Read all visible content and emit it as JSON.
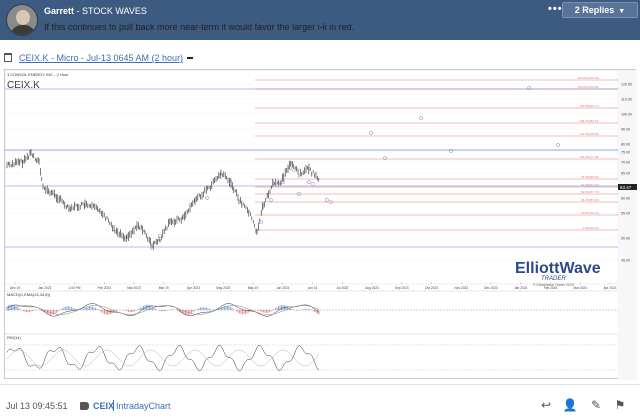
{
  "post": {
    "author": "Garrett",
    "separator": " - ",
    "thread_title": "STOCK WAVES",
    "replies_label": "2 Replies",
    "more_label": "•••",
    "message": "If this continues to pull back more near-term it would favor the larger i-ii in red.",
    "attachment_label": "CEIX.K - Micro - Jul-13 0645 AM (2 hour)",
    "timestamp": "Jul 13 09:45:51",
    "tag_symbol": "CEIX",
    "tag_chart": "IntradayChart"
  },
  "icons": {
    "trash": "trash-icon",
    "more": "more-dots-icon",
    "chevron": "chevron-down-icon",
    "tag": "tag-icon",
    "reply": "reply-icon",
    "add_user": "add-user-icon",
    "edit": "edit-icon",
    "flag": "flag-icon"
  },
  "colors": {
    "header_bg": "#3d5a80",
    "link": "#3d6fb6",
    "fib_line": "#e07a7a",
    "price_line": "#6b7fd6",
    "candles": "#222222"
  },
  "chart_data": {
    "type": "line",
    "symbol_title": "CEIX.K",
    "company_line": "1 CONSOL ENERGY INC - 2 Hour",
    "x_labels": [
      "Dec 19",
      "Jan 2023",
      "1:00 PM",
      "Feb 2023",
      "Mar 2023",
      "Mar 19",
      "Apr 2023",
      "May 2023",
      "May 19",
      "Jun 2023",
      "Jun 16",
      "Jul 2023",
      "Aug 2023",
      "Sep 2023",
      "Oct 2023",
      "Nov 2023",
      "Dec 2023",
      "Jan 2024",
      "Feb 2024",
      "Mar 2024",
      "Apr 2024"
    ],
    "y_ticks": [
      "120.00",
      "110.00",
      "100.00",
      "90.00",
      "80.00",
      "75.00",
      "70.00",
      "65.00",
      "60.00",
      "55.00",
      "50.00",
      "45.00"
    ],
    "fib_levels": [
      "223.6%(109.39)",
      "200.0%(100.82)",
      "161.8%(90.77)",
      "138.2%(83.47)",
      "123.6%(78.95)",
      "100.0%(72.28)",
      "76.4%(65.20)",
      "61.8%(61.22)",
      "50.0%(57.73)",
      "38.2%(54.25)",
      "23.6%(51.11)",
      "0.0%(46.66)"
    ],
    "last_price": "63.47",
    "indicator_1_label": "MACD(C,EMA(13,34,8))",
    "indicator_2_label": "RSI(14)",
    "brand_line1": "ElliottWave",
    "brand_line2": "TRADER",
    "brand_copyright": "© ElliottWave Trader 2023"
  }
}
